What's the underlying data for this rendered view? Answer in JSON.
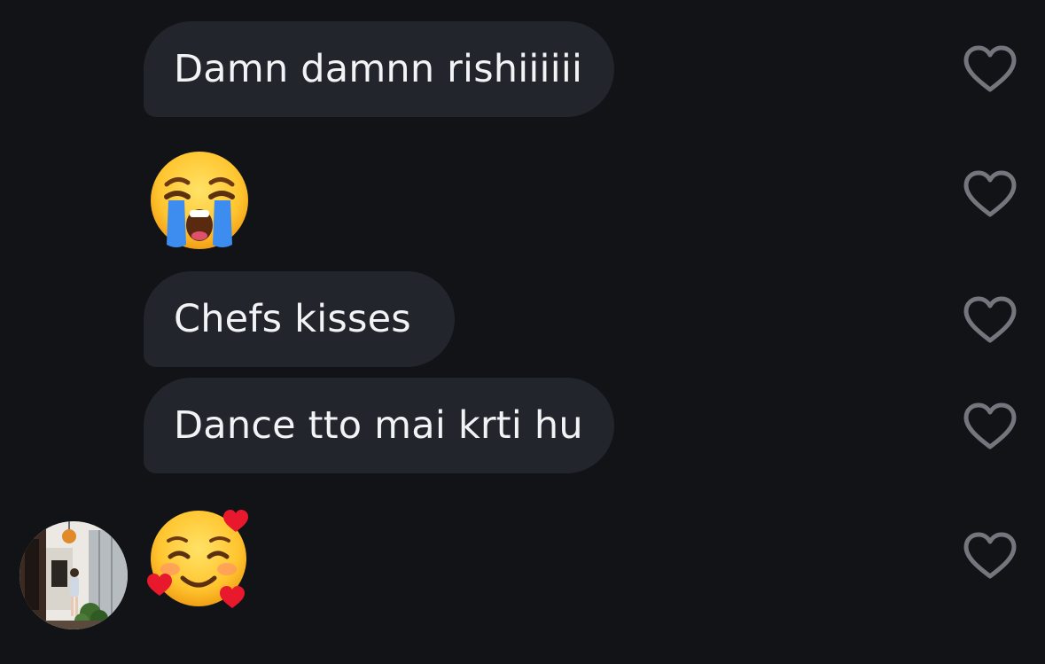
{
  "messages": [
    {
      "type": "text",
      "text": "Damn damnn rishiiiiii"
    },
    {
      "type": "emoji",
      "emoji": "loudly-crying-face"
    },
    {
      "type": "text",
      "text": "Chefs kisses"
    },
    {
      "type": "text",
      "text": "Dance tto mai krti hu"
    },
    {
      "type": "emoji",
      "emoji": "smiling-face-with-hearts"
    }
  ],
  "colors": {
    "background": "#121317",
    "bubble": "#23252d",
    "text": "#f2f3f5",
    "heart_outline": "#74767d"
  },
  "icons": {
    "like": "heart-outline-icon",
    "avatar": "sender-avatar-photo"
  }
}
